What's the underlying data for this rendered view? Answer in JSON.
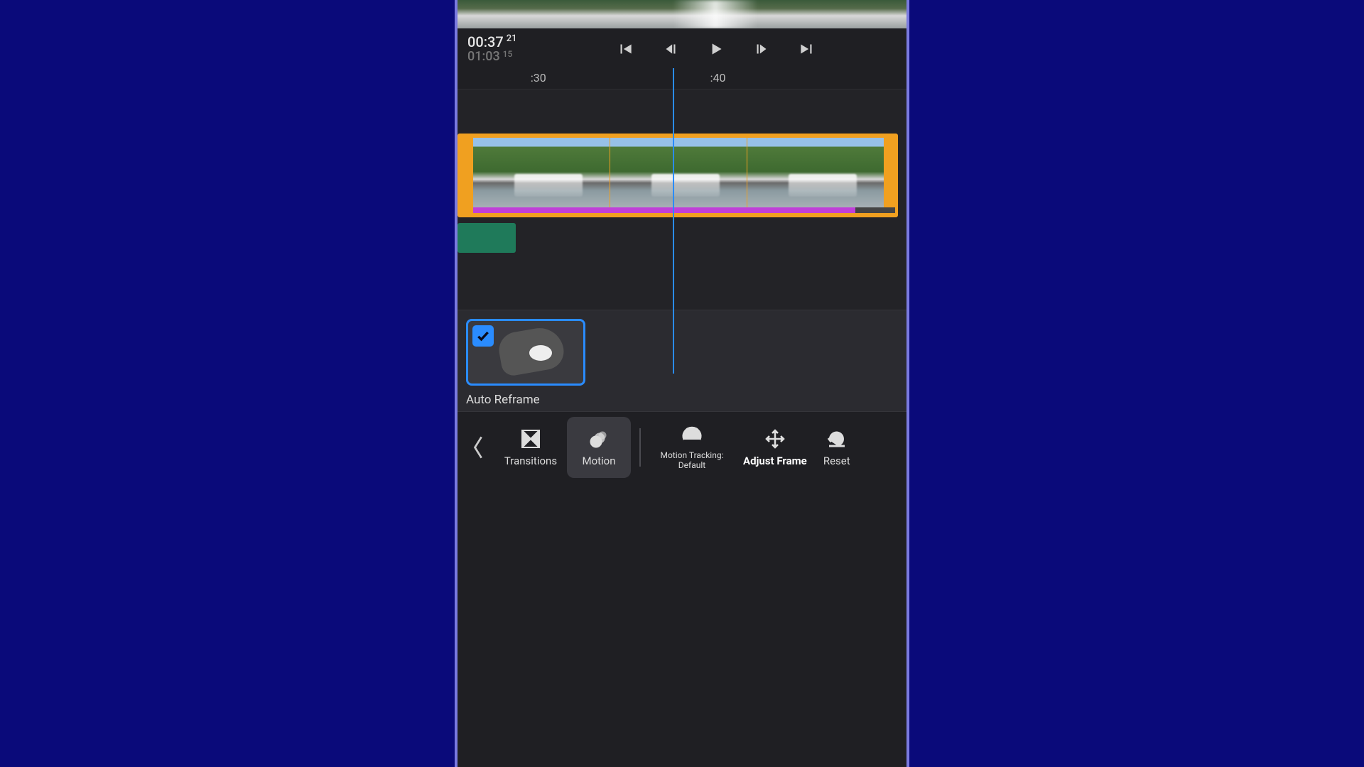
{
  "timecode": {
    "current": "00:37",
    "current_frames": "21",
    "total": "01:03",
    "total_frames": "15"
  },
  "ruler": {
    "marks": [
      {
        "label": ":30",
        "pct": 18
      },
      {
        "label": ":40",
        "pct": 58
      }
    ]
  },
  "playhead_pct": 48,
  "option": {
    "label": "Auto Reframe",
    "checked": true
  },
  "toolbar": {
    "back": "Back",
    "items": [
      {
        "key": "transitions",
        "label": "Transitions",
        "active": false
      },
      {
        "key": "motion",
        "label": "Motion",
        "active": true
      },
      {
        "key": "motion_tracking",
        "label_line1": "Motion Tracking:",
        "label_line2": "Default",
        "active": false
      },
      {
        "key": "adjust_frame",
        "label": "Adjust Frame",
        "active": false,
        "bold": true
      },
      {
        "key": "reset",
        "label": "Reset",
        "active": false
      }
    ]
  }
}
